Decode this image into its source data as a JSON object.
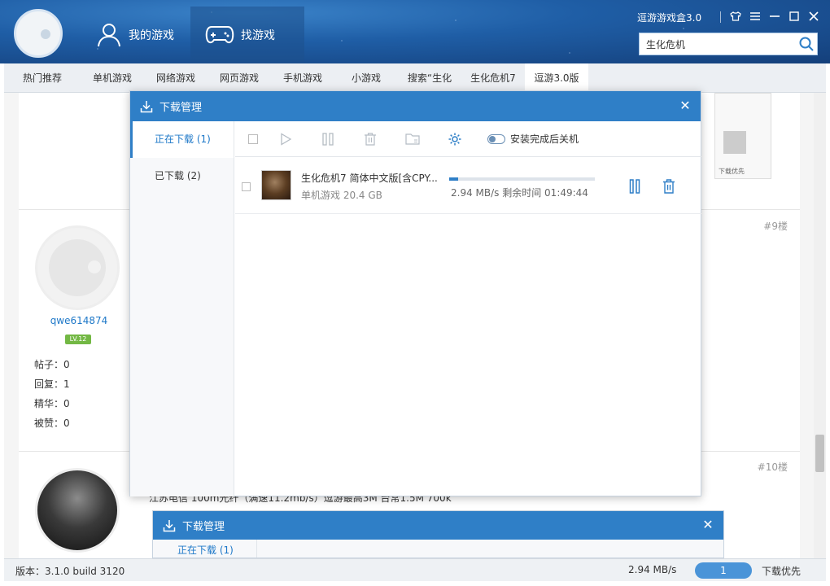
{
  "header": {
    "app_title": "逗游游戏盒3.0",
    "nav_my_games": "我的游戏",
    "nav_find_games": "找游戏",
    "search_value": "生化危机",
    "accent": "#2f7fc7"
  },
  "tabs": [
    {
      "label": "热门推荐"
    },
    {
      "label": "单机游戏"
    },
    {
      "label": "网络游戏"
    },
    {
      "label": "网页游戏"
    },
    {
      "label": "手机游戏"
    },
    {
      "label": "小游戏"
    },
    {
      "label": "搜索“生化"
    },
    {
      "label": "生化危机7"
    },
    {
      "label": "逗游3.0版"
    }
  ],
  "forum": {
    "post1": {
      "floor": "#9楼",
      "username": "qwe614874",
      "level": "LV.12",
      "stats": [
        "帖子：0",
        "回复：1",
        "精华：0",
        "被赞：0"
      ]
    },
    "post2": {
      "floor": "#10楼",
      "text": "江苏电信 100m光纤（满速11.2mb/s）逗游最高3M  台常1.5M  700k"
    },
    "side_label": "下载优先"
  },
  "download_dialog": {
    "title": "下载管理",
    "close_glyph": "✕",
    "side_downloading": "正在下载 (1)",
    "side_downloaded": "已下载 (2)",
    "toggle_label": "安装完成后关机",
    "item": {
      "title": "生化危机7  简体中文版[含CPY...",
      "meta": "单机游戏  20.4 GB",
      "progress": 0.06,
      "speed_line": "2.94 MB/s  剩余时间 01:49:44"
    }
  },
  "download_dialog_2": {
    "title": "下载管理",
    "side_downloading": "正在下载 (1)"
  },
  "statusbar": {
    "version": "版本：3.1.0 build 3120",
    "speed": "2.94 MB/s",
    "count": "1",
    "priority": "下载优先"
  }
}
